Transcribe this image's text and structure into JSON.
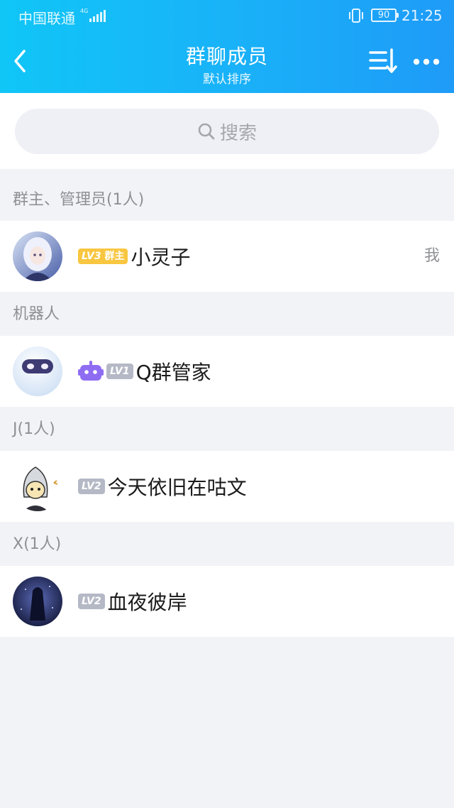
{
  "status_bar": {
    "carrier": "中国联通",
    "network": "4G",
    "battery": "90",
    "time": "21:25"
  },
  "header": {
    "title": "群聊成员",
    "subtitle": "默认排序",
    "icons": [
      "back-icon",
      "sort-icon",
      "more-icon"
    ]
  },
  "search": {
    "placeholder": "搜索"
  },
  "sections": [
    {
      "title": "群主、管理员(1人)",
      "members": [
        {
          "level": "LV3",
          "role": "群主",
          "name": "小灵子",
          "note": "我"
        }
      ]
    },
    {
      "title": "机器人",
      "members": [
        {
          "level": "LV1",
          "name": "Q群管家",
          "icon": "robot-icon"
        }
      ]
    },
    {
      "title": "J(1人)",
      "members": [
        {
          "level": "LV2",
          "name": "今天依旧在咕文"
        }
      ]
    },
    {
      "title": "X(1人)",
      "members": [
        {
          "level": "LV2",
          "name": "血夜彼岸"
        }
      ]
    }
  ],
  "colors": {
    "header_start": "#10c6f7",
    "header_end": "#1e9bf8",
    "owner_badge": "#f8c640",
    "level_badge": "#b5b9c6",
    "background": "#f2f3f7"
  }
}
